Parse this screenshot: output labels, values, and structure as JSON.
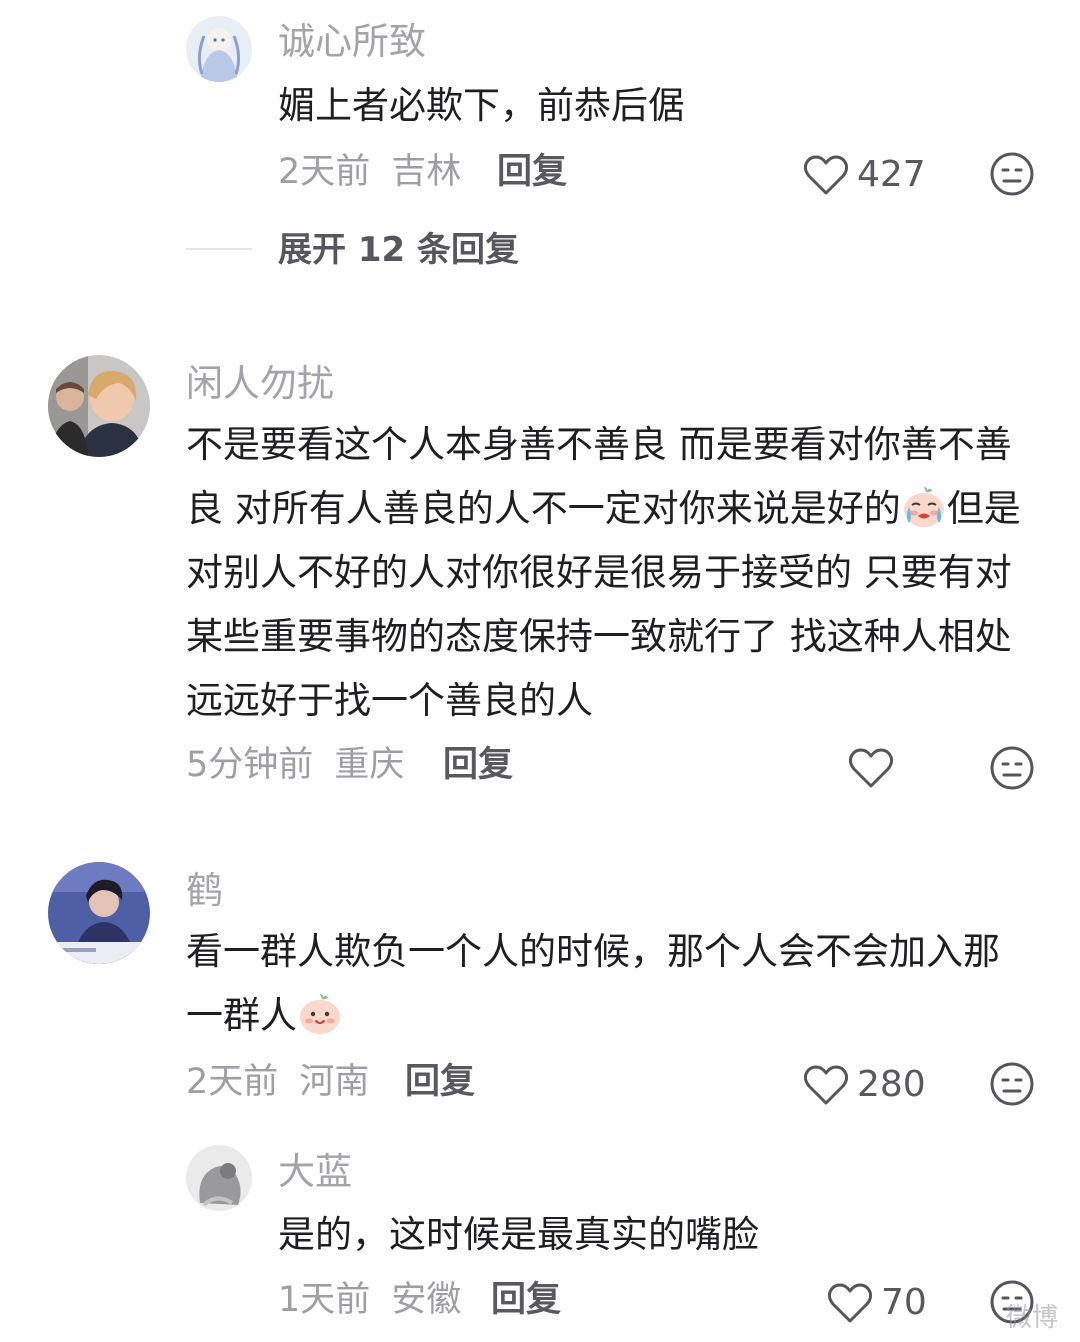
{
  "comments": [
    {
      "username": "诚心所致",
      "text": "媚上者必欺下，前恭后倨",
      "time": "2天前",
      "location": "吉林",
      "reply_label": "回复",
      "likes": "427",
      "expand_label": "展开 12 条回复"
    },
    {
      "username": "闲人勿扰",
      "text_part1": "不是要看这个人本身善不善良 而是要看对你善不善良 对所有人善良的人不一定对你来说是好的",
      "text_part2": "但是对别人不好的人对你很好是很易于接受的 只要有对某些重要事物的态度保持一致就行了 找这种人相处远远好于找一个善良的人",
      "time": "5分钟前",
      "location": "重庆",
      "reply_label": "回复"
    },
    {
      "username": "鹤",
      "text_part1": "看一群人欺负一个人的时候，那个人会不会加入那一群人",
      "time": "2天前",
      "location": "河南",
      "reply_label": "回复",
      "likes": "280"
    },
    {
      "username": "大蓝",
      "text": "是的，这时候是最真实的嘴脸",
      "time": "1天前",
      "location": "安徽",
      "reply_label": "回复",
      "likes": "70"
    }
  ],
  "watermark": "微博"
}
